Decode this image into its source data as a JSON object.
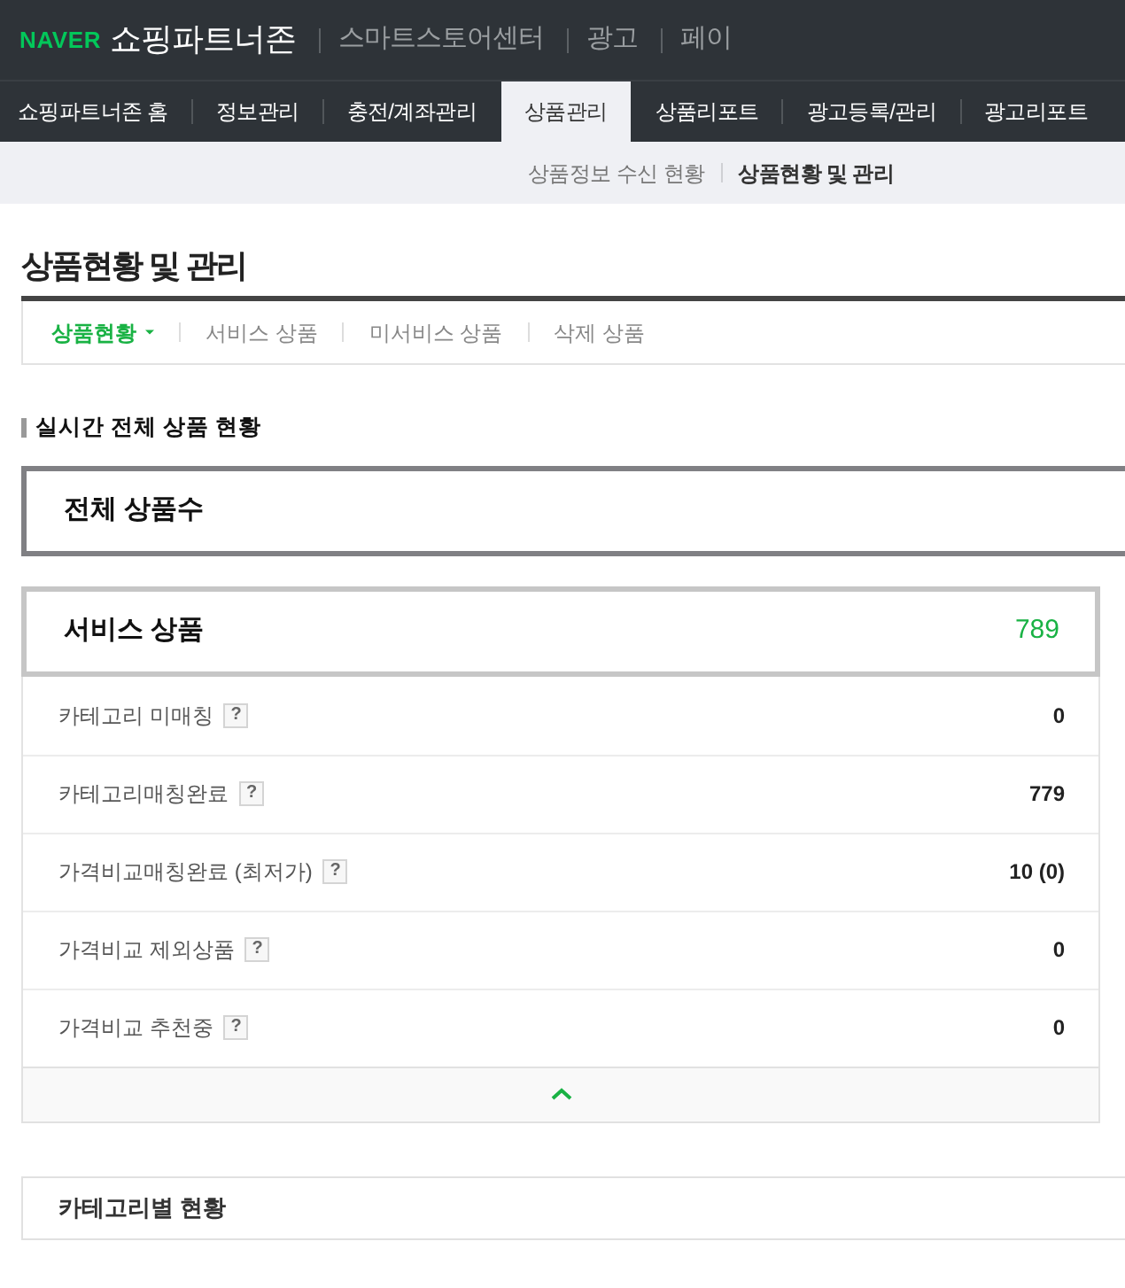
{
  "header": {
    "logo": "NAVER",
    "title": "쇼핑파트너존",
    "links": [
      "스마트스토어센터",
      "광고",
      "페이"
    ]
  },
  "nav": {
    "tabs": [
      {
        "label": "쇼핑파트너존 홈",
        "selected": false
      },
      {
        "label": "정보관리",
        "selected": false
      },
      {
        "label": "충전/계좌관리",
        "selected": false
      },
      {
        "label": "상품관리",
        "selected": true
      },
      {
        "label": "상품리포트",
        "selected": false
      },
      {
        "label": "광고등록/관리",
        "selected": false
      },
      {
        "label": "광고리포트",
        "selected": false
      }
    ]
  },
  "subnav": {
    "items": [
      {
        "label": "상품정보 수신 현황",
        "selected": false
      },
      {
        "label": "상품현황 및 관리",
        "selected": true
      }
    ]
  },
  "page": {
    "title": "상품현황 및 관리",
    "tabs": [
      {
        "label": "상품현황",
        "selected": true,
        "dropdown": true
      },
      {
        "label": "서비스 상품",
        "selected": false,
        "dropdown": false
      },
      {
        "label": "미서비스 상품",
        "selected": false,
        "dropdown": false
      },
      {
        "label": "삭제 상품",
        "selected": false,
        "dropdown": false
      }
    ]
  },
  "section": {
    "heading": "실시간 전체 상품 현황",
    "total": {
      "label": "전체 상품수"
    },
    "service": {
      "label": "서비스 상품",
      "value": "789",
      "expanded": true,
      "rows": [
        {
          "label": "카테고리 미매칭",
          "help": "?",
          "value": "0"
        },
        {
          "label": "카테고리매칭완료",
          "help": "?",
          "value": "779"
        },
        {
          "label": "가격비교매칭완료 (최저가)",
          "help": "?",
          "value": "10 (0)"
        },
        {
          "label": "가격비교 제외상품",
          "help": "?",
          "value": "0"
        },
        {
          "label": "가격비교 추천중",
          "help": "?",
          "value": "0"
        }
      ]
    }
  },
  "category_panel": {
    "label": "카테고리별 현황"
  }
}
